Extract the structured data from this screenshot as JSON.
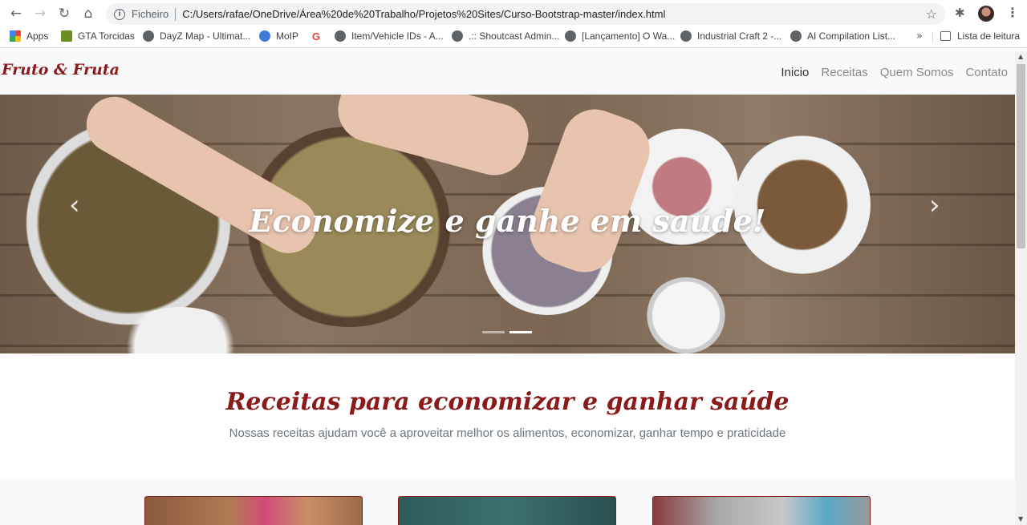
{
  "browser": {
    "scheme_label": "Ficheiro",
    "url": "C:/Users/rafae/OneDrive/Área%20de%20Trabalho/Projetos%20Sites/Curso-Bootstrap-master/index.html",
    "bookmarks": [
      {
        "label": "Apps",
        "icon": "apps-grid-icon"
      },
      {
        "label": "GTA Torcidas",
        "icon": "gta-icon"
      },
      {
        "label": "DayZ Map - Ultimat...",
        "icon": "globe-icon"
      },
      {
        "label": "MoIP",
        "icon": "moip-icon"
      },
      {
        "label": "",
        "icon": "google-icon"
      },
      {
        "label": "Item/Vehicle IDs - A...",
        "icon": "globe-icon"
      },
      {
        "label": ".:: Shoutcast Admin...",
        "icon": "globe-icon"
      },
      {
        "label": "[Lançamento] O Wa...",
        "icon": "globe-icon"
      },
      {
        "label": "Industrial Craft 2 -...",
        "icon": "globe-icon"
      },
      {
        "label": "AI Compilation List...",
        "icon": "globe-icon"
      }
    ],
    "more_bookmarks": "»",
    "reading_list": "Lista de leitura"
  },
  "site": {
    "brand": "Fruto & Fruta",
    "nav": [
      {
        "label": "Inicio",
        "active": true
      },
      {
        "label": "Receitas",
        "active": false
      },
      {
        "label": "Quem Somos",
        "active": false
      },
      {
        "label": "Contato",
        "active": false
      }
    ],
    "hero": {
      "caption": "Economize e ganhe em saúde!",
      "slide_count": 2,
      "active_slide": 2
    },
    "section": {
      "title": "Receitas para economizar e ganhar saúde",
      "subtitle": "Nossas receitas ajudam você a aproveitar melhor os alimentos, economizar, ganhar tempo e praticidade"
    }
  },
  "colors": {
    "brand": "#8b1a1a",
    "navbar_bg": "#f8f9fa",
    "muted_text": "#6c757d"
  }
}
